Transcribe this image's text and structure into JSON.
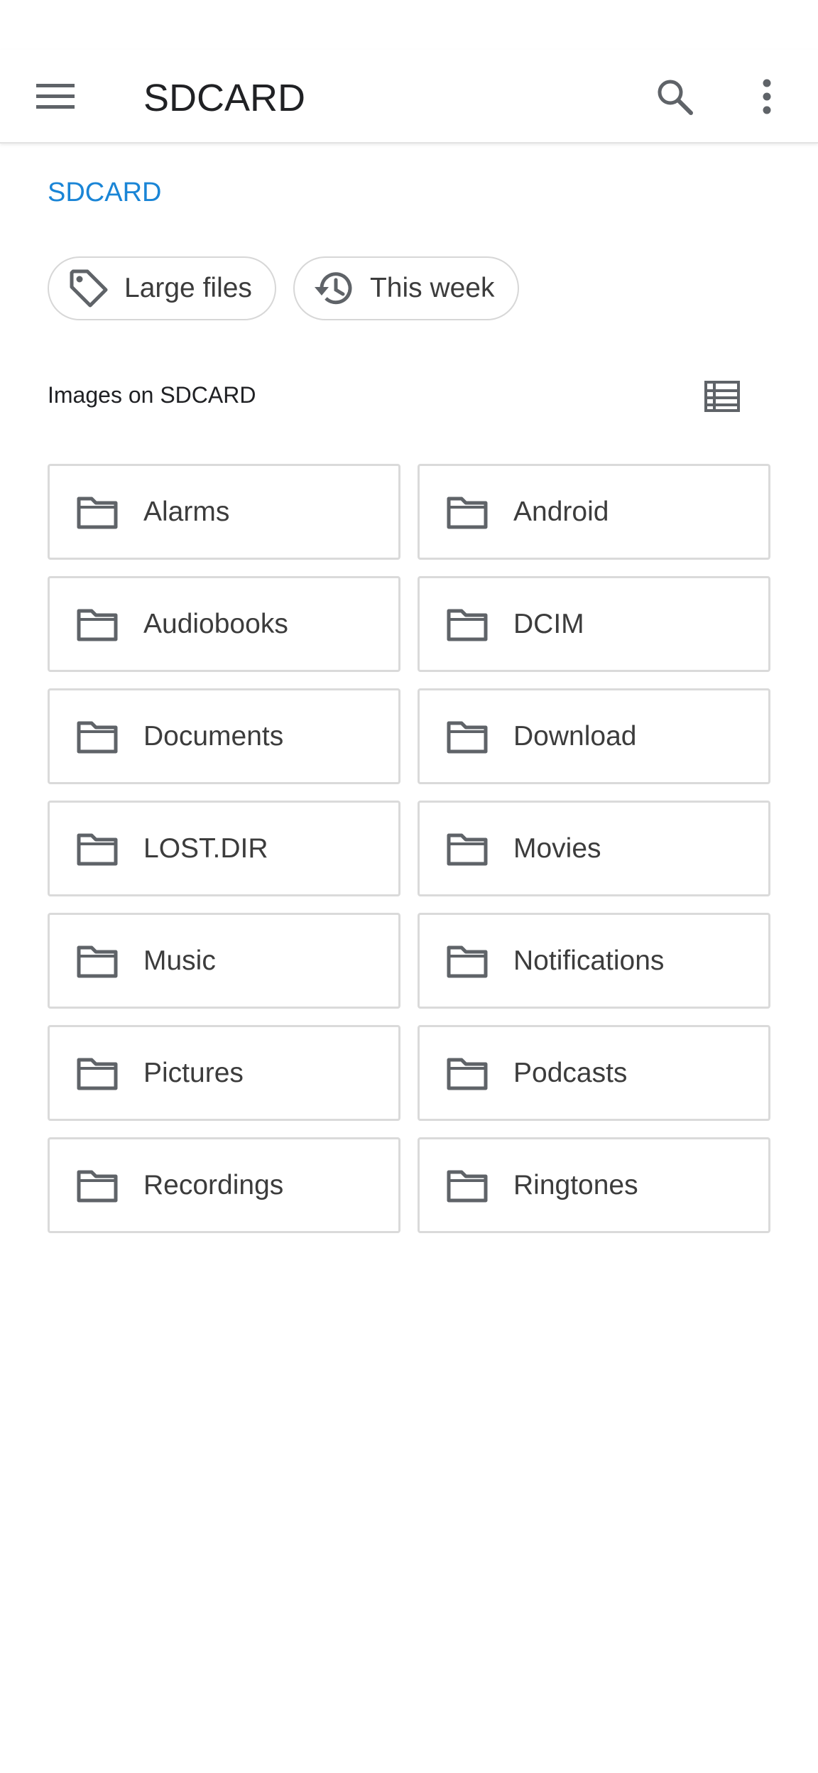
{
  "app_bar": {
    "title": "SDCARD",
    "menu_icon": "hamburger-menu-icon",
    "search_icon": "search-icon",
    "more_icon": "more-vert-icon"
  },
  "breadcrumb": {
    "root": "SDCARD"
  },
  "chips": [
    {
      "label": "Large files",
      "icon": "tag-icon"
    },
    {
      "label": "This week",
      "icon": "history-icon"
    }
  ],
  "section": {
    "label": "Images on SDCARD",
    "view_toggle_icon": "list-view-icon"
  },
  "folders": [
    {
      "label": "Alarms"
    },
    {
      "label": "Android"
    },
    {
      "label": "Audiobooks"
    },
    {
      "label": "DCIM"
    },
    {
      "label": "Documents"
    },
    {
      "label": "Download"
    },
    {
      "label": "LOST.DIR"
    },
    {
      "label": "Movies"
    },
    {
      "label": "Music"
    },
    {
      "label": "Notifications"
    },
    {
      "label": "Pictures"
    },
    {
      "label": "Podcasts"
    },
    {
      "label": "Recordings"
    },
    {
      "label": "Ringtones"
    }
  ],
  "colors": {
    "accent": "#1a85d6",
    "icon": "#5f6368",
    "border": "#dadada"
  }
}
